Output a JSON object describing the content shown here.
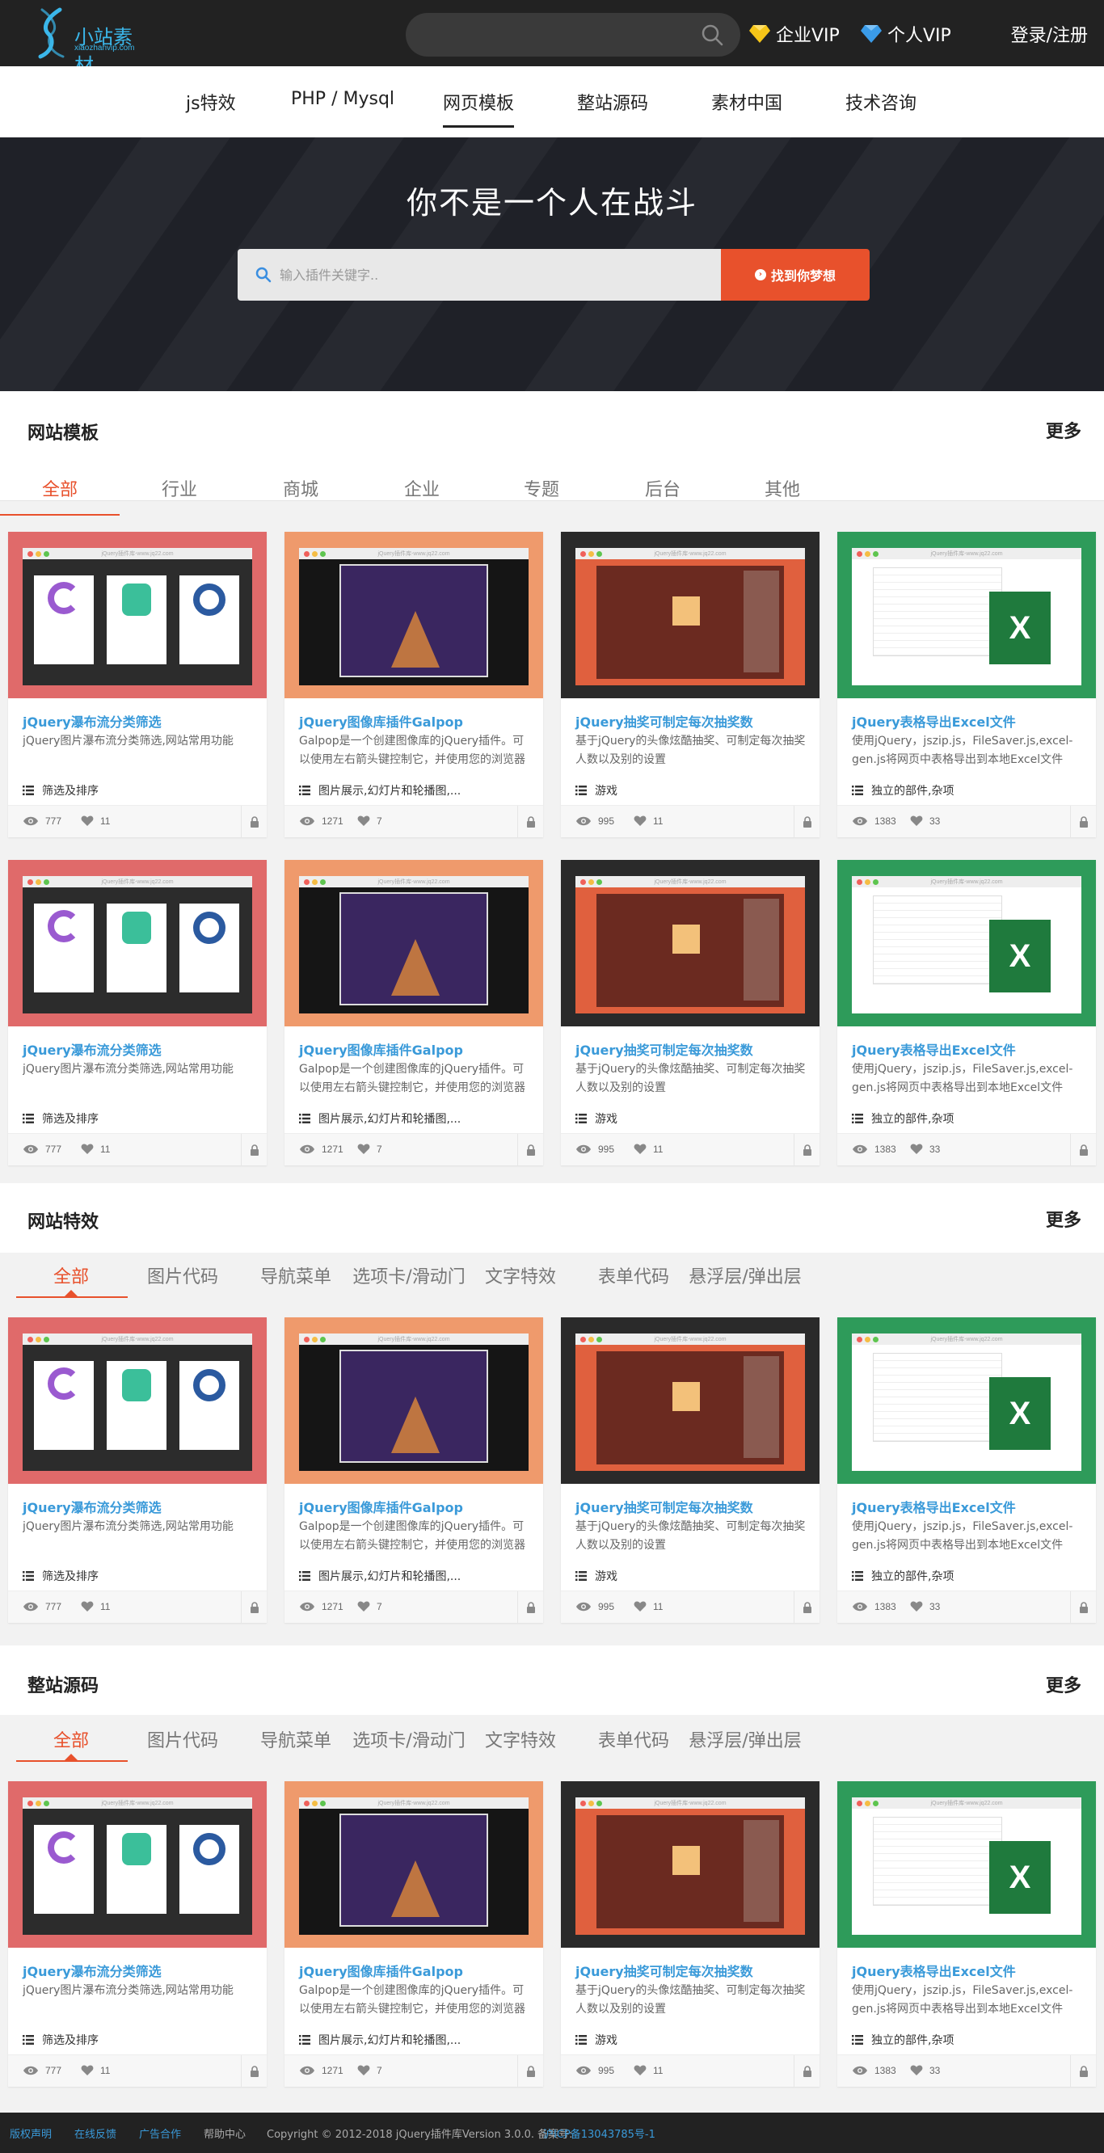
{
  "header": {
    "logo_text": "小站素材",
    "logo_sub": "xiaozhanvip.com",
    "enterprise_vip": "企业VIP",
    "personal_vip": "个人VIP",
    "login": "登录/注册"
  },
  "nav": {
    "items": [
      {
        "label": "js特效"
      },
      {
        "label": "PHP / Mysql"
      },
      {
        "label": "网页模板"
      },
      {
        "label": "整站源码"
      },
      {
        "label": "素材中国"
      },
      {
        "label": "技术咨询"
      }
    ],
    "active": 2
  },
  "hero": {
    "title": "你不是一个人在战斗",
    "search_placeholder": "输入插件关键字..",
    "button_label": "找到你梦想"
  },
  "sections": [
    {
      "title": "网站模板",
      "more": "更多",
      "tabs": [
        "全部",
        "行业",
        "商城",
        "企业",
        "专题",
        "后台",
        "其他"
      ]
    },
    {
      "title": "网站特效",
      "more": "更多",
      "tabs": [
        "全部",
        "图片代码",
        "导航菜单",
        "选项卡/滑动门",
        "文字特效",
        "表单代码",
        "悬浮层/弹出层"
      ]
    },
    {
      "title": "整站源码",
      "more": "更多",
      "tabs": [
        "全部",
        "图片代码",
        "导航菜单",
        "选项卡/滑动门",
        "文字特效",
        "表单代码",
        "悬浮层/弹出层"
      ]
    }
  ],
  "cards": [
    {
      "title": "jQuery瀑布流分类筛选",
      "desc": "jQuery图片瀑布流分类筛选,网站常用功能",
      "tags": "筛选及排序",
      "views": "777",
      "likes": "11",
      "frame_color": "#e06a6a",
      "browser_label": "jQuery插件库-www.jq22.com"
    },
    {
      "title": "jQuery图像库插件Galpop",
      "desc": "Galpop是一个创建图像库的jQuery插件。可以使用左右箭头键控制它，并使用您的浏览器自",
      "tags": "图片展示,幻灯片和轮播图,...",
      "views": "1271",
      "likes": "7",
      "frame_color": "#ef9a6c",
      "browser_label": "jQuery插件库-www.jq22.com"
    },
    {
      "title": "jQuery抽奖可制定每次抽奖数",
      "desc": "基于jQuery的头像炫酷抽奖、可制定每次抽奖人数以及别的设置",
      "tags": "游戏",
      "views": "995",
      "likes": "11",
      "frame_color": "#2a2a2a",
      "browser_label": "jQuery插件库-www.jq22.com"
    },
    {
      "title": "jQuery表格导出Excel文件",
      "desc": "使用jQuery，jszip.js，FileSaver.js,excel-gen.js将网页中表格导出到本地Excel文件",
      "tags": "独立的部件,杂项",
      "views": "1383",
      "likes": "33",
      "frame_color": "#2e9b5a",
      "browser_label": "jQuery插件库-www.jq22.com"
    }
  ],
  "footer": {
    "links": [
      "版权声明",
      "在线反馈",
      "广告合作",
      "帮助中心"
    ],
    "copyright": "Copyright © 2012-2018 jQuery插件库Version 3.0.0. 备案号:",
    "icp": "沪ICP备13043785号-1"
  }
}
